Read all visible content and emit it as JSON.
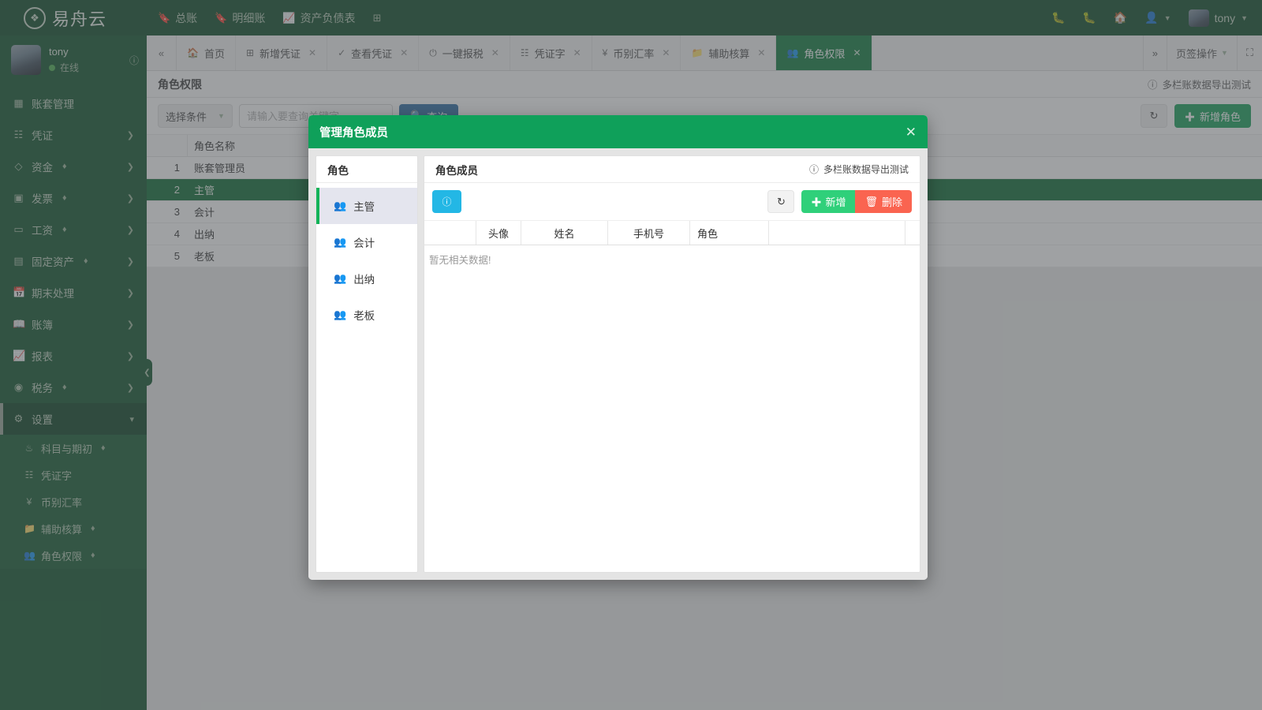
{
  "brand": {
    "logo_icon": "lotus-logo-icon",
    "name": "易舟云"
  },
  "topnav": [
    {
      "icon": "book-icon",
      "label": "总账"
    },
    {
      "icon": "book-icon",
      "label": "明细账"
    },
    {
      "icon": "chart-icon",
      "label": "资产负债表"
    },
    {
      "icon": "plus-square-icon",
      "label": ""
    }
  ],
  "topbar_right": {
    "icons": [
      "bug-icon",
      "bug-icon",
      "home-icon",
      "user-icon"
    ],
    "username": "tony"
  },
  "profile": {
    "name": "tony",
    "status": "在线",
    "info_icon": "info-icon"
  },
  "sidebar": {
    "items": [
      {
        "icon": "archive-icon",
        "label": "账套管理",
        "vip": false,
        "arrow": false
      },
      {
        "icon": "voucher-icon",
        "label": "凭证",
        "vip": false,
        "arrow": true
      },
      {
        "icon": "cash-icon",
        "label": "资金",
        "vip": true,
        "arrow": true
      },
      {
        "icon": "invoice-icon",
        "label": "发票",
        "vip": true,
        "arrow": true
      },
      {
        "icon": "card-icon",
        "label": "工资",
        "vip": true,
        "arrow": true
      },
      {
        "icon": "building-icon",
        "label": "固定资产",
        "vip": true,
        "arrow": true
      },
      {
        "icon": "calendar-icon",
        "label": "期末处理",
        "vip": false,
        "arrow": true
      },
      {
        "icon": "ledger-icon",
        "label": "账簿",
        "vip": false,
        "arrow": true
      },
      {
        "icon": "report-chart-icon",
        "label": "报表",
        "vip": false,
        "arrow": true
      },
      {
        "icon": "tax-icon",
        "label": "税务",
        "vip": true,
        "arrow": true
      }
    ],
    "settings": {
      "icon": "gear-icon",
      "label": "设置",
      "arrow": "chevron-down-icon"
    },
    "sub_items": [
      {
        "icon": "sitemap-icon",
        "label": "科目与期初",
        "vip": true
      },
      {
        "icon": "voucher-word-icon",
        "label": "凭证字",
        "vip": false
      },
      {
        "icon": "yuan-icon",
        "label": "币别汇率",
        "vip": false
      },
      {
        "icon": "folder-icon",
        "label": "辅助核算",
        "vip": true
      },
      {
        "icon": "users-icon",
        "label": "角色权限",
        "vip": true
      }
    ],
    "collapse_icon": "chevron-left-icon"
  },
  "tabs": {
    "prev_icon": "double-chevron-left-icon",
    "items": [
      {
        "icon": "home-icon",
        "label": "首页",
        "closable": false,
        "active": false
      },
      {
        "icon": "plus-square-icon",
        "label": "新增凭证",
        "closable": true,
        "active": false
      },
      {
        "icon": "check-circle-icon",
        "label": "查看凭证",
        "closable": true,
        "active": false
      },
      {
        "icon": "power-icon",
        "label": "一键报税",
        "closable": true,
        "active": false
      },
      {
        "icon": "book-icon",
        "label": "凭证字",
        "closable": true,
        "active": false
      },
      {
        "icon": "yuan-icon",
        "label": "币别汇率",
        "closable": true,
        "active": false
      },
      {
        "icon": "folder-icon",
        "label": "辅助核算",
        "closable": true,
        "active": false
      },
      {
        "icon": "users-icon",
        "label": "角色权限",
        "closable": true,
        "active": true
      }
    ],
    "next_icon": "double-chevron-right-icon",
    "ops_label": "页签操作",
    "ops_caret": "caret-down-icon",
    "fullscreen_icon": "fullscreen-icon"
  },
  "page": {
    "title": "角色权限",
    "note": "多栏账数据导出测试",
    "note_icon": "info-icon",
    "toolbar": {
      "select_condition_label": "选择条件",
      "select_caret": "caret-down-icon",
      "search_placeholder": "请输入要查询关键字",
      "search_value": "",
      "query_label": "查询",
      "query_icon": "search-icon",
      "refresh_icon": "refresh-icon",
      "add_role_label": "新增角色",
      "add_role_icon": "plus-icon"
    },
    "grid": {
      "columns": [
        "",
        "角色名称"
      ],
      "rows": [
        {
          "index": "1",
          "name": "账套管理员",
          "selected": false
        },
        {
          "index": "2",
          "name": "主管",
          "selected": true
        },
        {
          "index": "3",
          "name": "会计",
          "selected": false
        },
        {
          "index": "4",
          "name": "出纳",
          "selected": false
        },
        {
          "index": "5",
          "name": "老板",
          "selected": false
        }
      ]
    }
  },
  "modal": {
    "title": "管理角色成员",
    "close_icon": "close-icon",
    "roles_panel": {
      "title": "角色",
      "items": [
        {
          "icon": "users-icon",
          "label": "主管",
          "active": true
        },
        {
          "icon": "users-icon",
          "label": "会计",
          "active": false
        },
        {
          "icon": "users-icon",
          "label": "出纳",
          "active": false
        },
        {
          "icon": "users-icon",
          "label": "老板",
          "active": false
        }
      ]
    },
    "members_panel": {
      "title": "角色成员",
      "note": "多栏账数据导出测试",
      "note_icon": "info-icon",
      "info_button_icon": "info-icon",
      "refresh_icon": "refresh-icon",
      "new_label": "新增",
      "new_icon": "plus-icon",
      "delete_label": "删除",
      "delete_icon": "trash-icon",
      "columns": [
        "",
        "头像",
        "姓名",
        "手机号",
        "角色",
        "",
        ""
      ],
      "empty_text": "暂无相关数据!"
    }
  },
  "colors": {
    "brand_dark_green": "#0d4a26",
    "sidebar_green": "#0e532b",
    "modal_header_green": "#0fa05a",
    "active_tab_green": "#0f7a3d",
    "selected_row_green": "#0c6b34",
    "add_button_green": "#18a05a",
    "new_button_green": "#2fd07a",
    "delete_button_red": "#fa6450",
    "info_button_blue": "#23b7e5",
    "query_button_blue": "#2e6da4"
  }
}
